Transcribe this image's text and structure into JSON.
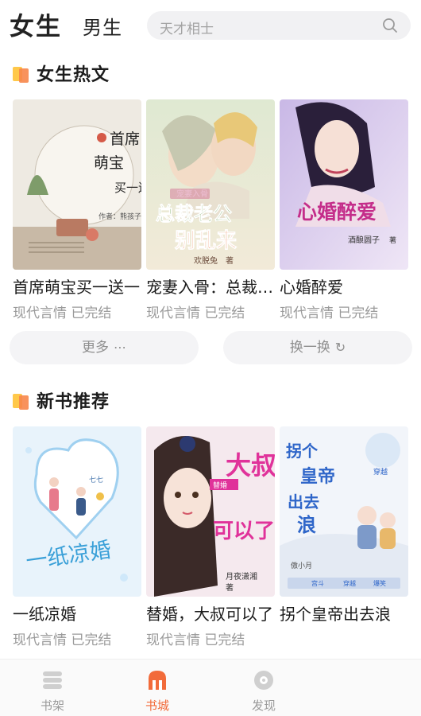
{
  "header": {
    "tabs": [
      {
        "label": "女生",
        "active": true
      },
      {
        "label": "男生",
        "active": false
      }
    ],
    "search_placeholder": "天才相士"
  },
  "sections": [
    {
      "title": "女生热文",
      "books": [
        {
          "title": "首席萌宝买一送一",
          "meta": "现代言情 已完结",
          "cover_text": [
            "首席",
            "萌宝",
            "买一送一",
            "作者：熊孩子/文"
          ]
        },
        {
          "title": "宠妻入骨：总裁老公别乱来",
          "meta": "现代言情 已完结",
          "cover_text": [
            "宠妻入骨",
            "总裁老公",
            "别乱来",
            "欢脱兔",
            "著"
          ]
        },
        {
          "title": "心婚醉爱",
          "meta": "现代言情 已完结",
          "cover_text": [
            "心婚醉爱",
            "酒酿圆子",
            "著"
          ]
        }
      ],
      "buttons": [
        {
          "label": "更多",
          "icon": "⋯"
        },
        {
          "label": "换一换",
          "icon": "↻"
        }
      ]
    },
    {
      "title": "新书推荐",
      "books": [
        {
          "title": "一纸凉婚",
          "meta": "现代言情 已完结",
          "cover_text": [
            "一纸凉婚",
            "七七"
          ]
        },
        {
          "title": "替婚，大叔可以了",
          "meta": "现代言情 已完结",
          "cover_text": [
            "替婚",
            "大叔",
            "可以了",
            "月夜潇湘",
            "著"
          ]
        },
        {
          "title": "拐个皇帝出去浪",
          "meta": "",
          "cover_text": [
            "拐个",
            "皇帝",
            "出去",
            "浪",
            "穿越",
            "傲小月",
            "宫斗",
            "穿越",
            "爆笑"
          ]
        }
      ]
    }
  ],
  "bottom_nav": [
    {
      "label": "书架",
      "icon": "bookshelf-icon",
      "active": false
    },
    {
      "label": "书城",
      "icon": "bookstore-icon",
      "active": true
    },
    {
      "label": "发现",
      "icon": "discover-icon",
      "active": false
    }
  ],
  "colors": {
    "accent": "#f26b3a",
    "section_icon_orange": "#f7a64a",
    "section_icon_yellow": "#ffc84a"
  }
}
